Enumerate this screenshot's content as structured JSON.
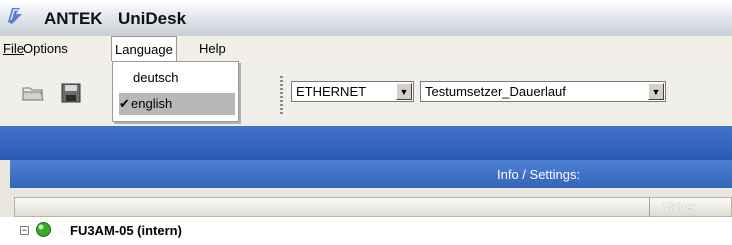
{
  "window": {
    "brand": "ANTEK",
    "app": "UniDesk",
    "icon": "app-logo-icon"
  },
  "menu": {
    "file": "File",
    "options": "Options",
    "language": "Language",
    "help": "Help"
  },
  "language_menu": {
    "items": [
      {
        "label": "deutsch",
        "checked": false
      },
      {
        "label": "english",
        "checked": true
      }
    ],
    "check_mark": "✔"
  },
  "toolbar": {
    "open_icon": "folder-open-icon",
    "save_icon": "floppy-disk-icon",
    "connection_combo": {
      "value": "ETHERNET"
    },
    "device_combo": {
      "value": "Testumsetzer_Dauerlauf"
    }
  },
  "panel": {
    "title": "Info / Settings:",
    "column_value": "Value:"
  },
  "tree": {
    "expander": "−",
    "node": "FU3AM-05 (intern)",
    "node_icon": "green-status-icon"
  }
}
